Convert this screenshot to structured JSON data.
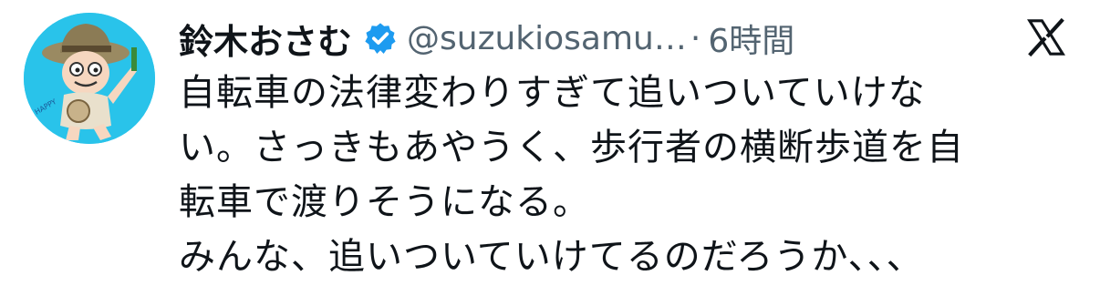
{
  "author": {
    "display_name": "鈴木おさむ",
    "handle": "@suzukiosamu…",
    "separator": "·",
    "time": "6時間",
    "verified_icon": "verified-badge-icon",
    "avatar_icon": "cartoon-avatar"
  },
  "platform": {
    "logo_icon": "x-logo-icon"
  },
  "tweet": {
    "lines": [
      "自転車の法律変わりすぎて追いついていけな",
      "い。さっきもあやうく、歩行者の横断歩道を自",
      "転車で渡りそうになる。",
      "みんな、追いついていけてるのだろうか、、、"
    ]
  },
  "colors": {
    "verified_blue": "#1d9bf0",
    "avatar_bg": "#29c3ea",
    "text": "#0f1419",
    "secondary_text": "#536471"
  }
}
